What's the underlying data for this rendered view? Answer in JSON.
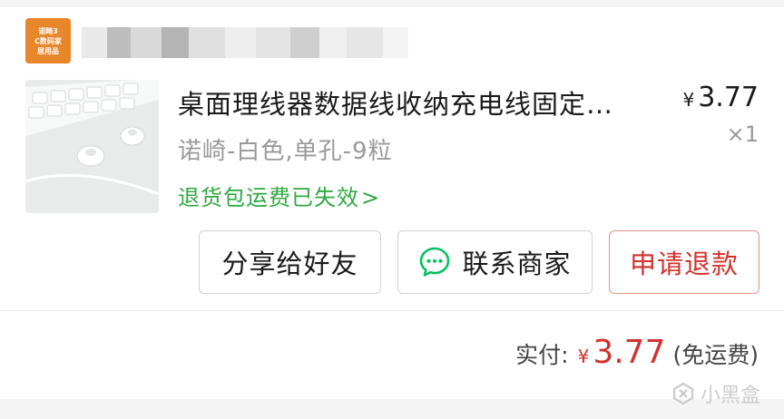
{
  "store": {
    "logo_lines": [
      "诺畸3",
      "C数码家",
      "居用品"
    ]
  },
  "product": {
    "title": "桌面理线器数据线收纳充电线固定…",
    "price_symbol": "¥",
    "price": "3.77",
    "quantity": "×1",
    "spec": "诺崎-白色,单孔-9粒",
    "return_note": "退货包运费已失效",
    "return_chevron": ">"
  },
  "actions": {
    "share_label": "分享给好友",
    "contact_label": "联系商家",
    "refund_label": "申请退款"
  },
  "total": {
    "label": "实付:",
    "currency": "¥",
    "amount": "3.77",
    "shipping_note": "(免运费)"
  },
  "watermark": {
    "text": "小黑盒"
  },
  "colors": {
    "accent_red": "#d2322d",
    "accent_green": "#2fa83f",
    "logo_orange": "#e8862a",
    "wechat_green": "#07c160"
  }
}
